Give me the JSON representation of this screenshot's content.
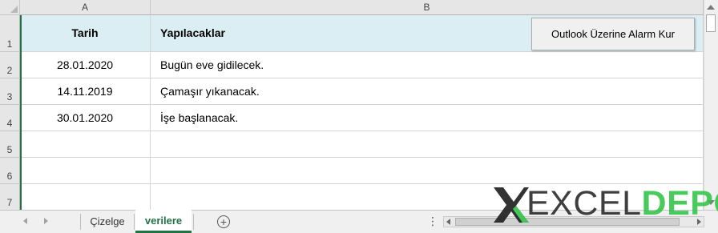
{
  "columns": [
    {
      "letter": "A"
    },
    {
      "letter": "B"
    }
  ],
  "rows": [
    "1",
    "2",
    "3",
    "4",
    "5",
    "6",
    "7"
  ],
  "header_row": {
    "a": "Tarih",
    "b": "Yapılacaklar",
    "fill_color": "#daeef3"
  },
  "data_rows": [
    {
      "tarih": "28.01.2020",
      "yapilacak": "Bugün eve gidilecek."
    },
    {
      "tarih": "14.11.2019",
      "yapilacak": "Çamaşır yıkanacak."
    },
    {
      "tarih": "30.01.2020",
      "yapilacak": "İşe başlanacak."
    }
  ],
  "button": {
    "label": "Outlook Üzerine Alarm Kur"
  },
  "tabs": {
    "sheets": [
      {
        "label": "Çizelge",
        "active": false
      },
      {
        "label": "verilere",
        "active": true
      }
    ],
    "add_icon": "plus-circle-icon",
    "more_icon": "vertical-ellipsis-icon"
  },
  "watermark": {
    "part1": "EXCEL",
    "part2": "DEPO",
    "accent": "#35c64b"
  },
  "colors": {
    "accent": "#217346",
    "header_fill": "#daeef3"
  }
}
